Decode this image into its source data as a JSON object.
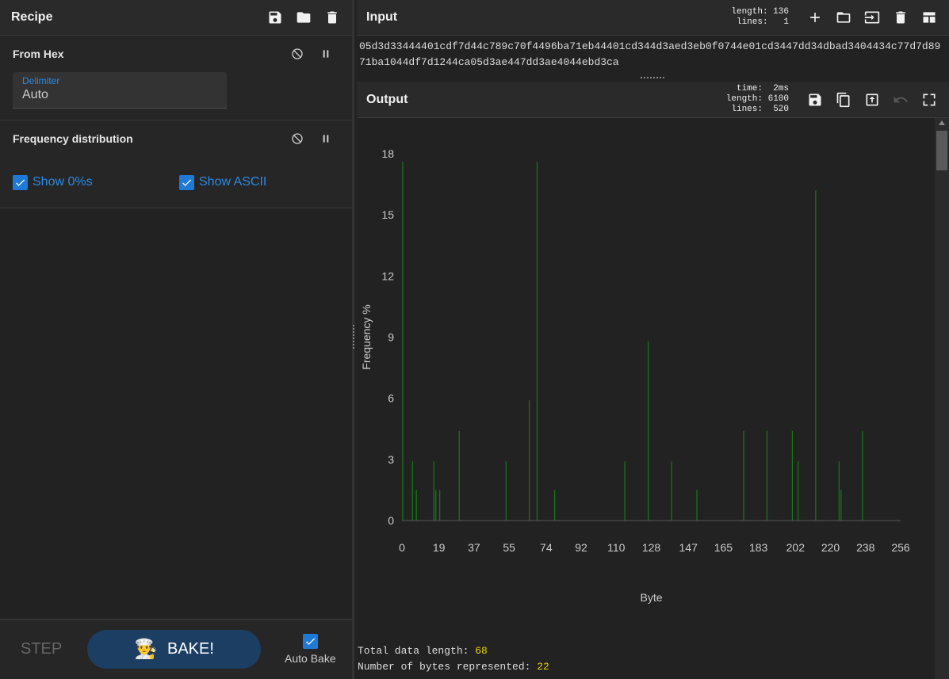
{
  "recipe": {
    "title": "Recipe",
    "operations": [
      {
        "name": "From Hex",
        "field_label": "Delimiter",
        "field_value": "Auto"
      },
      {
        "name": "Frequency distribution",
        "show_zeros": "Show 0%s",
        "show_ascii": "Show ASCII"
      }
    ],
    "step_label": "STEP",
    "bake_label": "BAKE!",
    "autobake_label": "Auto Bake"
  },
  "input": {
    "title": "Input",
    "stats": "length: 136\n lines:   1",
    "text": "05d3d33444401cdf7d44c789c70f4496ba71eb44401cd344d3aed3eb0f0744e01cd3447dd34dbad3404434c77d7d8971ba1044df7d1244ca05d3ae447dd3ae4044ebd3ca"
  },
  "output": {
    "title": "Output",
    "stats": "time:  2ms\nlength: 6100\n lines:  520",
    "total_label": "Total data length: ",
    "total_value": "68",
    "bytes_label": "Number of bytes represented: ",
    "bytes_value": "22"
  },
  "chart_data": {
    "type": "bar",
    "title": "",
    "xlabel": "Byte",
    "ylabel": "Frequency %",
    "xlim": [
      0,
      256
    ],
    "ylim": [
      0,
      18
    ],
    "xticks": [
      0,
      19,
      37,
      55,
      74,
      92,
      110,
      128,
      147,
      165,
      183,
      202,
      220,
      238,
      256
    ],
    "yticks": [
      0,
      3,
      6,
      9,
      12,
      15,
      18
    ],
    "bar_color": "#1a7a1a",
    "x": [
      0,
      5,
      7,
      16,
      17,
      19,
      29,
      53,
      65,
      69,
      78,
      114,
      126,
      138,
      151,
      175,
      187,
      200,
      203,
      212,
      224,
      225,
      236
    ],
    "values": [
      17.6,
      2.9,
      1.5,
      2.9,
      1.5,
      1.5,
      4.4,
      2.9,
      5.9,
      17.6,
      1.5,
      2.9,
      8.8,
      2.9,
      1.5,
      4.4,
      4.4,
      4.4,
      2.9,
      16.2,
      2.9,
      1.5,
      4.4
    ]
  },
  "colors": {
    "accent": "#2b8ae6",
    "bake": "#1c3e63",
    "highlight": "#e6d600"
  }
}
